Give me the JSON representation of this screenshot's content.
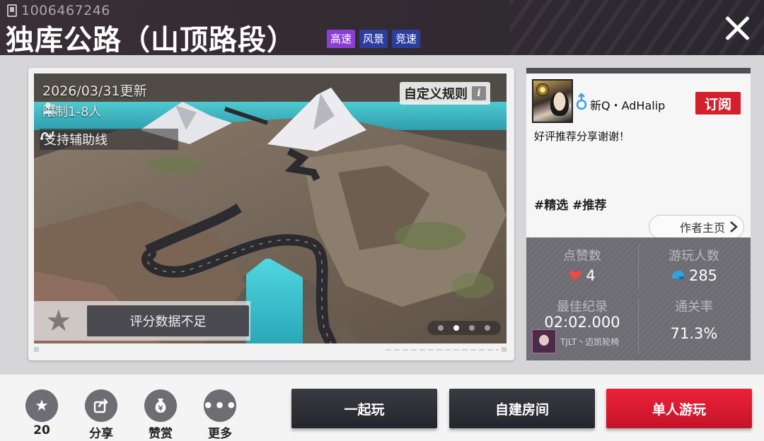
{
  "header": {
    "map_id": "1006467246",
    "title": "独库公路（山顶路段）",
    "tags": [
      "高速",
      "风景",
      "竞速"
    ]
  },
  "preview": {
    "update_date": "2026/03/31更新",
    "player_limit": "限制1-8人",
    "assist_line": "支持辅助线",
    "custom_rules": "自定义规则",
    "rating_text": "评分数据不足",
    "carousel": {
      "count": 4,
      "active_index": 1
    }
  },
  "author": {
    "name": "新Q・AdHalip",
    "subscribe_label": "订阅",
    "message": "好评推荐分享谢谢！",
    "tags": "#精选 #推荐",
    "home_label": "作者主页"
  },
  "stats": {
    "likes_label": "点赞数",
    "likes_value": "4",
    "players_label": "游玩人数",
    "players_value": "285",
    "best_record_label": "最佳纪录",
    "best_record_value": "02:02.000",
    "best_record_holder": "TJLT丶迈凯轮椅",
    "clear_rate_label": "通关率",
    "clear_rate_value": "71.3%"
  },
  "actions": {
    "favorite_count": "20",
    "share_label": "分享",
    "reward_label": "赞赏",
    "more_label": "更多"
  },
  "buttons": {
    "play_together": "一起玩",
    "create_room": "自建房间",
    "solo_play": "单人游玩"
  },
  "colors": {
    "accent_red": "#d51f2b",
    "tag_purple": "#8b3fd1",
    "tag_blue": "#2b3e9e",
    "header_bg": "#312a31"
  }
}
